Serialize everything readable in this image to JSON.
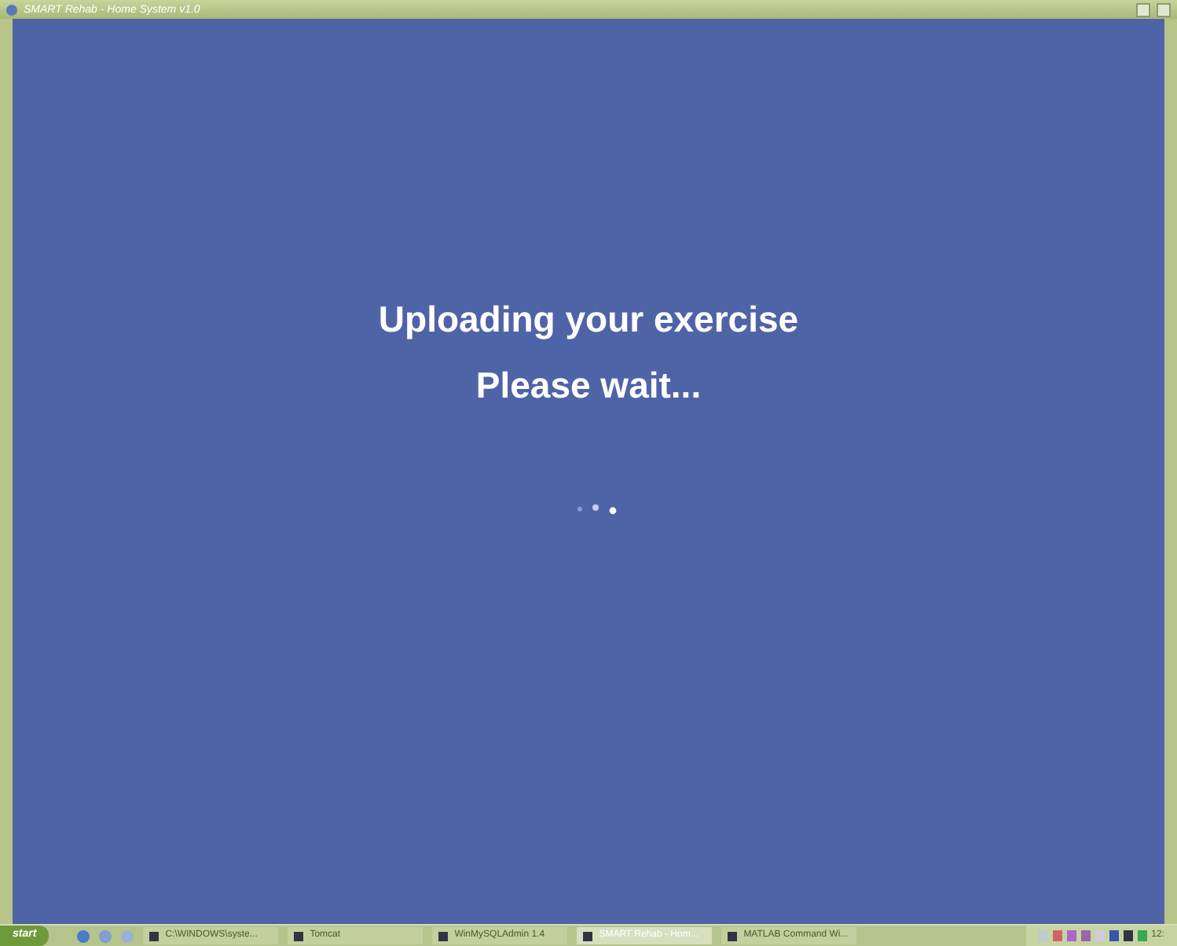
{
  "window": {
    "title": "SMART Rehab - Home System v1.0"
  },
  "message": {
    "lines": [
      "Uploading your exercise",
      "Please wait..."
    ]
  },
  "taskbar": {
    "start": "start",
    "tasks": [
      {
        "label": "C:\\WINDOWS\\syste...",
        "selected": false
      },
      {
        "label": "Tomcat",
        "selected": false
      },
      {
        "label": "WinMySQLAdmin 1.4",
        "selected": false
      },
      {
        "label": "SMART Rehab - Hom...",
        "selected": true
      },
      {
        "label": "MATLAB Command Wi...",
        "selected": false
      }
    ],
    "clock": "12:"
  }
}
